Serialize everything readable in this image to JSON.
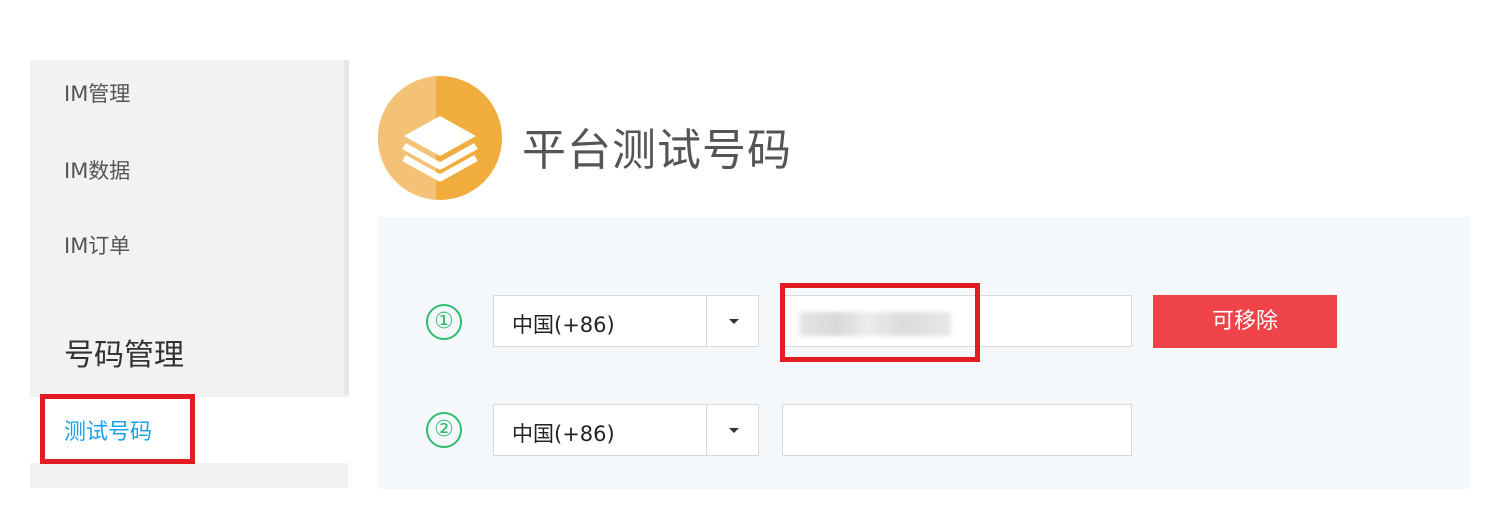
{
  "sidebar": {
    "items": [
      {
        "label": "IM管理"
      },
      {
        "label": "IM数据"
      },
      {
        "label": "IM订单"
      }
    ],
    "group_title": "号码管理",
    "active_item": "测试号码"
  },
  "header": {
    "title": "平台测试号码",
    "icon": "layers-icon"
  },
  "rows": [
    {
      "number": "①",
      "country": "中国(+86)",
      "phone_value": "",
      "action_label": "可移除"
    },
    {
      "number": "②",
      "country": "中国(+86)",
      "phone_value": ""
    }
  ],
  "colors": {
    "accent_blue": "#1aa3e8",
    "danger_red": "#ee4348",
    "success_green": "#2fbd72",
    "logo_orange": "#f0ac3c",
    "highlight_red": "#e31b23"
  }
}
